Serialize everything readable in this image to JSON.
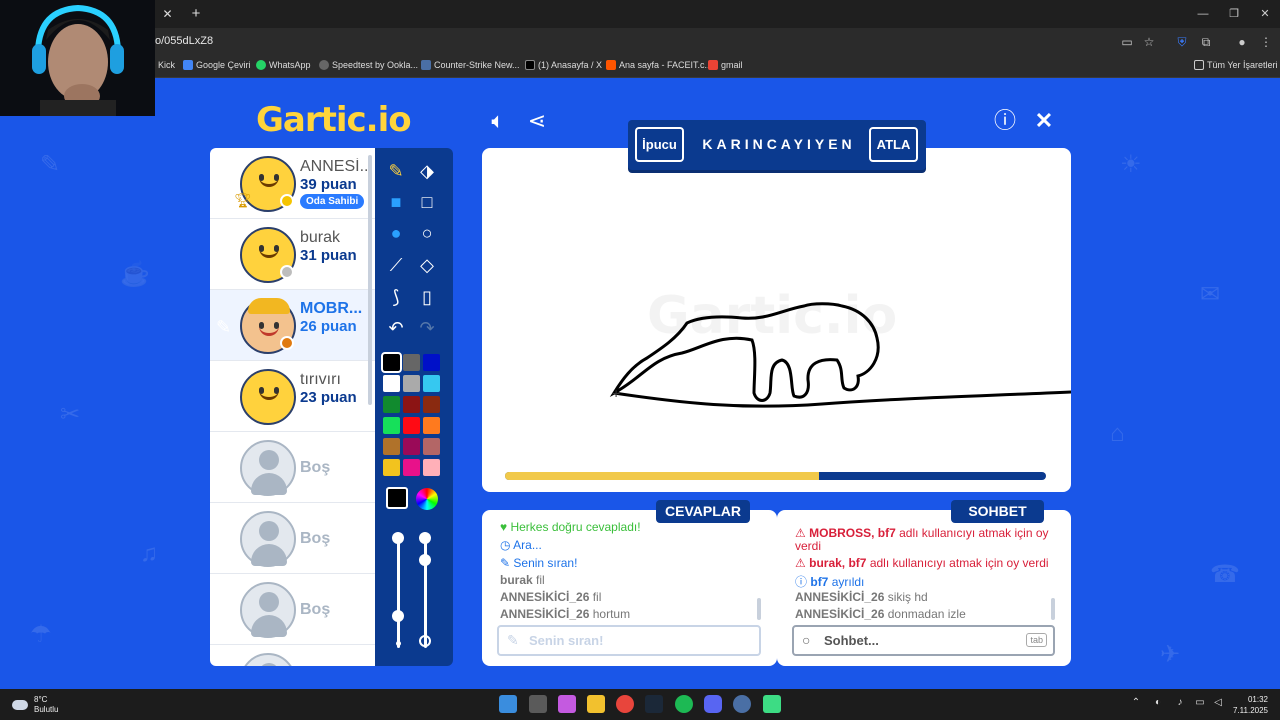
{
  "browser": {
    "tab_close": "✕",
    "new_tab": "+",
    "url": "o/055dLxZ8",
    "window_controls": [
      "—",
      "❐",
      "✕"
    ],
    "bookmarks": [
      {
        "label": "Kick",
        "color": "#53fc18"
      },
      {
        "label": "Google Çeviri",
        "color": "#4285f4"
      },
      {
        "label": "WhatsApp",
        "color": "#25d366"
      },
      {
        "label": "Speedtest by Ookla...",
        "color": "#666666"
      },
      {
        "label": "Counter-Strike New...",
        "color": "#4a6fa5"
      },
      {
        "label": "(1) Anasayfa / X",
        "color": "#000000"
      },
      {
        "label": "Ana sayfa - FACEIT.c...",
        "color": "#ff5500"
      },
      {
        "label": "gmail",
        "color": "#ea4335"
      }
    ],
    "all_bookmarks": "Tüm Yer İşaretleri"
  },
  "game": {
    "logo": "Gartic.io",
    "hint": {
      "hint_button": "İpucu",
      "word": "KARINCAYIYEN",
      "skip_button": "ATLA"
    },
    "players": [
      {
        "name": "ANNESİ...",
        "score": "39 puan",
        "badge": "Oda Sahibi",
        "dot": "#f5c400",
        "avatar": "yellow"
      },
      {
        "name": "burak",
        "score": "31 puan",
        "dot": "#bdbdbd",
        "avatar": "yellow"
      },
      {
        "name": "MOBR...",
        "score": "26 puan",
        "dot": "#e07a10",
        "avatar": "cap",
        "drawing": true
      },
      {
        "name": "tırıvırı",
        "score": "23 puan",
        "avatar": "yellow"
      },
      {
        "name": "Boş"
      },
      {
        "name": "Boş"
      },
      {
        "name": "Boş"
      }
    ],
    "progress": 0.58,
    "palette": [
      "#000000",
      "#666666",
      "#0010c8",
      "#ffffff",
      "#aaaaaa",
      "#36c8f0",
      "#118a2e",
      "#8c1414",
      "#8a2a10",
      "#16e05a",
      "#ff0a14",
      "#ff7a1e",
      "#b0722a",
      "#9a0a58",
      "#b36666",
      "#f2c31e",
      "#e8118a",
      "#ffb0b8"
    ],
    "answers": {
      "title": "CEVAPLAR",
      "messages": [
        {
          "icon": "♥",
          "text": "Herkes doğru cevapladı!",
          "color": "#3bbf3b"
        },
        {
          "icon": "◷",
          "text": "Ara...",
          "color": "#1e73e8"
        },
        {
          "icon": "✎",
          "text": "Senin sıran!",
          "color": "#1e73e8"
        },
        {
          "user": "burak",
          "text": "fil"
        },
        {
          "user": "ANNESİKİCİ_26",
          "text": "fil"
        },
        {
          "user": "ANNESİKİCİ_26",
          "text": "hortum"
        }
      ],
      "placeholder": "Senin sıran!"
    },
    "chat": {
      "title": "SOHBET",
      "messages": [
        {
          "icon": "⚠",
          "user": "MOBROSS, bf7",
          "text": "adlı kullanıcıyı atmak için oy",
          "cont": "verdi",
          "color": "#d8203a"
        },
        {
          "icon": "⚠",
          "user": "burak, bf7",
          "text": "adlı kullanıcıyı atmak için oy verdi",
          "color": "#d8203a"
        },
        {
          "icon": "ⓘ",
          "user": "bf7",
          "text": "ayrıldı",
          "color": "#1e73e8"
        },
        {
          "user": "ANNESİKİCİ_26",
          "text": "sikiş hd"
        },
        {
          "user": "ANNESİKİCİ_26",
          "text": "donmadan izle"
        }
      ],
      "placeholder": "Sohbet...",
      "tab_key": "tab"
    }
  },
  "taskbar": {
    "temp": "8°C",
    "weather": "Bulutlu",
    "time": "01:32",
    "date": "7.11.2025"
  }
}
